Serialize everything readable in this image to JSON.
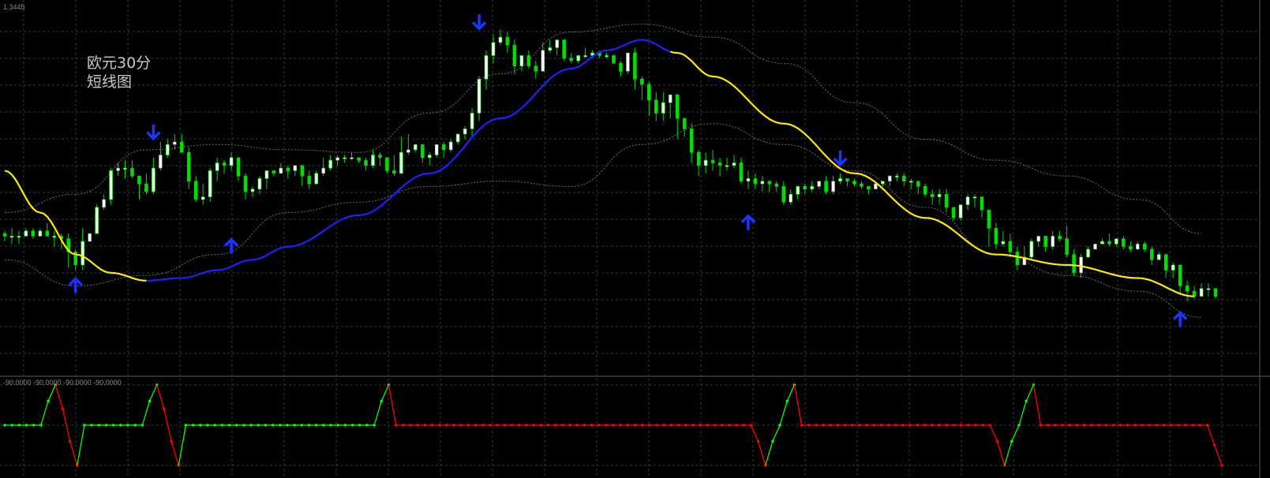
{
  "header": {
    "price_readout": "1.3445",
    "indicator_readout": "-90.0000  -90.0000  -90.0000  -90.0000"
  },
  "annotation": {
    "line1": "欧元30分",
    "line2": "短线图"
  },
  "colors": {
    "background": "#000000",
    "grid": "#2e3a2e",
    "bull_candle": "#ffffff",
    "bear_candle": "#00dd00",
    "envelope": "#6e6e6e",
    "ma_blue": "#1f1fff",
    "ma_yellow": "#ffea00",
    "arrow": "#1a35ff",
    "osc_up": "#00ff00",
    "osc_down": "#ff0000"
  },
  "chart_data": [
    {
      "type": "candlestick",
      "ylim": [
        0,
        100
      ],
      "candles": [
        [
          50,
          49,
          47,
          51
        ],
        [
          49,
          49,
          46,
          52
        ],
        [
          49,
          49,
          46,
          51
        ],
        [
          49,
          51,
          49,
          52
        ],
        [
          51,
          49,
          48,
          52
        ],
        [
          49,
          51,
          49,
          52
        ],
        [
          51,
          49,
          49,
          54
        ],
        [
          49,
          49,
          45,
          51
        ],
        [
          49,
          48,
          44,
          50
        ],
        [
          48,
          43,
          37,
          50
        ],
        [
          43,
          38,
          36,
          44
        ],
        [
          38,
          47,
          36,
          52
        ],
        [
          47,
          50,
          47,
          50
        ],
        [
          50,
          60,
          50,
          61
        ],
        [
          60,
          63,
          59,
          65
        ],
        [
          63,
          74,
          61,
          75
        ],
        [
          74,
          75,
          72,
          77
        ],
        [
          75,
          75,
          71,
          78
        ],
        [
          75,
          72,
          71,
          78
        ],
        [
          72,
          69,
          63,
          72
        ],
        [
          69,
          66,
          65,
          73
        ],
        [
          66,
          75,
          65,
          79
        ],
        [
          75,
          80,
          74,
          85
        ],
        [
          80,
          84,
          79,
          86
        ],
        [
          84,
          85,
          82,
          88
        ],
        [
          85,
          81,
          81,
          88
        ],
        [
          81,
          70,
          67,
          83
        ],
        [
          70,
          63,
          62,
          72
        ],
        [
          63,
          64,
          61,
          69
        ],
        [
          64,
          74,
          62,
          75
        ],
        [
          74,
          77,
          70,
          79
        ],
        [
          77,
          76,
          73,
          78
        ],
        [
          76,
          79,
          74,
          81
        ],
        [
          79,
          72,
          70,
          79
        ],
        [
          72,
          66,
          63,
          73
        ],
        [
          66,
          67,
          64,
          68
        ],
        [
          67,
          71,
          65,
          72
        ],
        [
          71,
          74,
          67,
          74
        ],
        [
          74,
          73,
          72,
          74
        ],
        [
          73,
          75,
          73,
          77
        ],
        [
          75,
          74,
          71,
          76
        ],
        [
          74,
          76,
          72,
          76
        ],
        [
          76,
          72,
          68,
          76
        ],
        [
          72,
          69,
          67,
          74
        ],
        [
          69,
          73,
          69,
          74
        ],
        [
          73,
          75,
          72,
          79
        ],
        [
          75,
          78,
          74,
          80
        ],
        [
          78,
          79,
          76,
          80
        ],
        [
          79,
          79,
          77,
          80
        ],
        [
          79,
          79,
          78,
          81
        ],
        [
          79,
          78,
          77,
          79
        ],
        [
          78,
          76,
          74,
          79
        ],
        [
          76,
          80,
          75,
          82
        ],
        [
          80,
          79,
          76,
          81
        ],
        [
          79,
          74,
          73,
          79
        ],
        [
          74,
          73,
          72,
          80
        ],
        [
          73,
          81,
          73,
          87
        ],
        [
          81,
          82,
          80,
          88
        ],
        [
          82,
          84,
          81,
          84
        ],
        [
          84,
          79,
          77,
          84
        ],
        [
          79,
          80,
          76,
          81
        ],
        [
          80,
          84,
          79,
          84
        ],
        [
          84,
          82,
          79,
          85
        ],
        [
          82,
          85,
          81,
          86
        ],
        [
          85,
          88,
          84,
          88
        ],
        [
          88,
          90,
          86,
          91
        ],
        [
          90,
          96,
          87,
          98
        ],
        [
          96,
          109,
          93,
          110
        ],
        [
          109,
          118,
          105,
          120
        ],
        [
          118,
          123,
          115,
          126
        ],
        [
          123,
          125,
          122,
          128
        ],
        [
          125,
          122,
          119,
          127
        ],
        [
          122,
          114,
          111,
          124
        ],
        [
          114,
          118,
          112,
          118
        ],
        [
          118,
          114,
          113,
          120
        ],
        [
          114,
          112,
          109,
          116
        ],
        [
          112,
          120,
          112,
          123
        ],
        [
          120,
          121,
          119,
          124
        ],
        [
          121,
          124,
          118,
          124
        ],
        [
          124,
          117,
          116,
          124
        ],
        [
          117,
          116,
          115,
          119
        ],
        [
          116,
          118,
          115,
          118
        ],
        [
          118,
          118,
          117,
          121
        ],
        [
          118,
          119,
          117,
          120
        ],
        [
          119,
          118,
          117,
          120
        ],
        [
          118,
          118,
          117,
          119
        ],
        [
          118,
          115,
          115,
          118
        ],
        [
          115,
          112,
          110,
          116
        ],
        [
          112,
          119,
          111,
          119
        ],
        [
          119,
          109,
          105,
          121
        ],
        [
          109,
          107,
          101,
          110
        ],
        [
          107,
          101,
          95,
          108
        ],
        [
          101,
          96,
          93,
          104
        ],
        [
          96,
          100,
          93,
          104
        ],
        [
          100,
          103,
          94,
          103
        ],
        [
          103,
          94,
          86,
          103
        ],
        [
          94,
          90,
          87,
          94
        ],
        [
          90,
          81,
          77,
          92
        ],
        [
          81,
          76,
          72,
          82
        ],
        [
          76,
          78,
          73,
          81
        ],
        [
          78,
          77,
          74,
          82
        ],
        [
          77,
          76,
          72,
          79
        ],
        [
          76,
          76,
          74,
          79
        ],
        [
          76,
          77,
          75,
          80
        ],
        [
          77,
          70,
          69,
          79
        ],
        [
          70,
          71,
          67,
          74
        ],
        [
          71,
          69,
          67,
          73
        ],
        [
          69,
          70,
          66,
          72
        ],
        [
          70,
          69,
          66,
          70
        ],
        [
          69,
          68,
          66,
          70
        ],
        [
          68,
          62,
          61,
          70
        ],
        [
          62,
          65,
          61,
          67
        ],
        [
          65,
          68,
          63,
          68
        ],
        [
          68,
          67,
          65,
          69
        ],
        [
          67,
          68,
          66,
          70
        ],
        [
          68,
          70,
          67,
          70
        ],
        [
          70,
          66,
          65,
          72
        ],
        [
          66,
          70,
          65,
          72
        ],
        [
          70,
          71,
          69,
          73
        ],
        [
          71,
          70,
          68,
          71
        ],
        [
          70,
          69,
          68,
          71
        ],
        [
          69,
          68,
          67,
          70
        ],
        [
          68,
          67,
          65,
          68
        ],
        [
          67,
          69,
          67,
          69
        ],
        [
          69,
          70,
          68,
          70
        ],
        [
          70,
          72,
          68,
          72
        ],
        [
          72,
          72,
          70,
          73
        ],
        [
          72,
          70,
          68,
          73
        ],
        [
          70,
          70,
          67,
          71
        ],
        [
          70,
          68,
          65,
          70
        ],
        [
          68,
          65,
          64,
          69
        ],
        [
          65,
          64,
          61,
          67
        ],
        [
          64,
          65,
          61,
          67
        ],
        [
          65,
          60,
          58,
          67
        ],
        [
          60,
          56,
          55,
          60
        ],
        [
          56,
          61,
          55,
          61
        ],
        [
          61,
          64,
          59,
          65
        ],
        [
          64,
          64,
          60,
          65
        ],
        [
          64,
          59,
          56,
          64
        ],
        [
          59,
          52,
          45,
          59
        ],
        [
          52,
          46,
          44,
          54
        ],
        [
          46,
          47,
          45,
          51
        ],
        [
          47,
          43,
          41,
          50
        ],
        [
          43,
          38,
          36,
          45
        ],
        [
          38,
          41,
          38,
          45
        ],
        [
          41,
          47,
          40,
          48
        ],
        [
          47,
          49,
          45,
          49
        ],
        [
          49,
          45,
          43,
          49
        ],
        [
          45,
          49,
          44,
          51
        ],
        [
          49,
          48,
          47,
          51
        ],
        [
          48,
          42,
          41,
          53
        ],
        [
          42,
          35,
          34,
          44
        ],
        [
          35,
          41,
          33,
          42
        ],
        [
          41,
          44,
          42,
          45
        ],
        [
          44,
          46,
          44,
          46
        ],
        [
          46,
          47,
          46,
          48
        ],
        [
          47,
          46,
          45,
          50
        ],
        [
          46,
          48,
          45,
          48
        ],
        [
          48,
          45,
          44,
          49
        ],
        [
          45,
          44,
          43,
          47
        ],
        [
          44,
          46,
          44,
          47
        ],
        [
          46,
          44,
          43,
          47
        ],
        [
          44,
          40,
          38,
          45
        ],
        [
          40,
          42,
          40,
          43
        ],
        [
          42,
          36,
          33,
          42
        ],
        [
          36,
          38,
          33,
          39
        ],
        [
          38,
          30,
          27,
          38
        ],
        [
          30,
          28,
          24,
          32
        ],
        [
          28,
          26,
          25,
          30
        ],
        [
          26,
          29,
          26,
          31
        ],
        [
          29,
          29,
          26,
          31
        ],
        [
          29,
          26,
          25,
          29
        ]
      ]
    },
    {
      "type": "line",
      "name_ref": "envelope_upper",
      "x": [
        0,
        10,
        20,
        30,
        40,
        50,
        60,
        70,
        80,
        90,
        100,
        110,
        120,
        130,
        140,
        150,
        160,
        169
      ],
      "y": [
        58,
        65,
        82,
        84,
        82,
        81,
        96,
        111,
        127,
        130,
        125,
        115,
        100,
        86,
        78,
        72,
        63,
        50
      ]
    },
    {
      "type": "line",
      "name_ref": "envelope_lower",
      "x": [
        0,
        10,
        20,
        30,
        40,
        50,
        60,
        70,
        80,
        90,
        100,
        110,
        120,
        130,
        140,
        150,
        160,
        169
      ],
      "y": [
        40,
        30,
        34,
        42,
        58,
        62,
        68,
        70,
        68,
        84,
        92,
        84,
        74,
        60,
        42,
        34,
        28,
        18
      ]
    },
    {
      "type": "line",
      "name_ref": "moving_average",
      "x": [
        0,
        5,
        10,
        15,
        20,
        25,
        30,
        35,
        40,
        50,
        60,
        70,
        80,
        85,
        90,
        95,
        100,
        110,
        120,
        130,
        140,
        150,
        160,
        168
      ],
      "y": [
        74,
        58,
        42,
        35,
        32,
        33,
        36,
        40,
        45,
        57,
        73,
        94,
        113,
        120,
        124,
        119,
        110,
        92,
        73,
        56,
        42,
        38,
        33,
        26
      ],
      "blue_range": [
        20,
        94
      ]
    },
    {
      "type": "scatter",
      "name_ref": "arrows",
      "down": [
        {
          "x": 21,
          "y": 89
        },
        {
          "x": 67,
          "y": 131
        },
        {
          "x": 118,
          "y": 79
        }
      ],
      "up": [
        {
          "x": 10,
          "y": 30
        },
        {
          "x": 32,
          "y": 45
        },
        {
          "x": 105,
          "y": 54
        },
        {
          "x": 166,
          "y": 17
        }
      ]
    },
    {
      "type": "line",
      "name_ref": "oscillator",
      "ylim": [
        -100,
        100
      ],
      "y": [
        0,
        0,
        0,
        0,
        0,
        0,
        60,
        100,
        40,
        -40,
        -100,
        0,
        0,
        0,
        0,
        0,
        0,
        0,
        0,
        0,
        60,
        100,
        40,
        -40,
        -100,
        0,
        0,
        0,
        0,
        0,
        0,
        0,
        0,
        0,
        0,
        0,
        0,
        0,
        0,
        0,
        0,
        0,
        0,
        0,
        0,
        0,
        0,
        0,
        0,
        0,
        0,
        0,
        60,
        100,
        0,
        0,
        0,
        0,
        0,
        0,
        0,
        0,
        0,
        0,
        0,
        0,
        0,
        0,
        0,
        0,
        0,
        0,
        0,
        0,
        0,
        0,
        0,
        0,
        0,
        0,
        0,
        0,
        0,
        0,
        0,
        0,
        0,
        0,
        0,
        0,
        0,
        0,
        0,
        0,
        0,
        0,
        0,
        0,
        0,
        0,
        0,
        0,
        0,
        0,
        -40,
        -100,
        -40,
        0,
        60,
        100,
        0,
        0,
        0,
        0,
        0,
        0,
        0,
        0,
        0,
        0,
        0,
        0,
        0,
        0,
        0,
        0,
        0,
        0,
        0,
        0,
        0,
        0,
        0,
        0,
        0,
        0,
        0,
        -40,
        -100,
        -40,
        0,
        60,
        100,
        0,
        0,
        0,
        0,
        0,
        0,
        0,
        0,
        0,
        0,
        0,
        0,
        0,
        0,
        0,
        0,
        0,
        0,
        0,
        0,
        0,
        0,
        0,
        0,
        -50,
        -100
      ]
    }
  ]
}
